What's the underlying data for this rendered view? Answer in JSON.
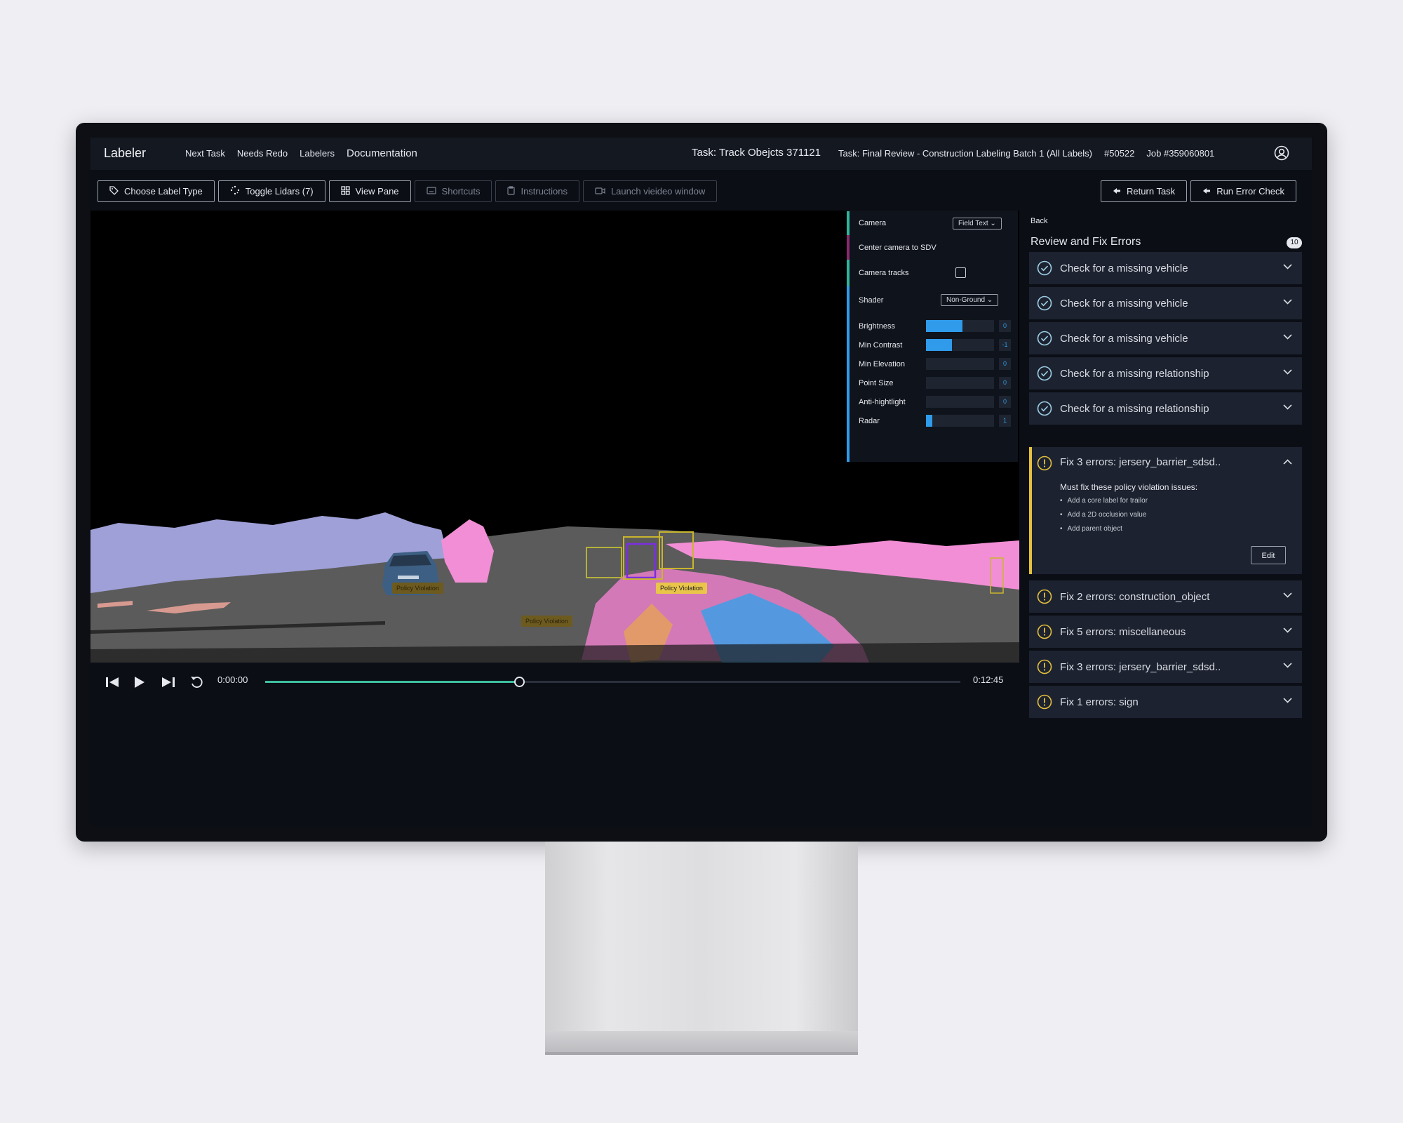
{
  "header": {
    "brand": "Labeler",
    "nav": [
      "Next Task",
      "Needs Redo",
      "Labelers",
      "Documentation"
    ],
    "task_title": "Task: Track Obejcts 371121",
    "task_review": "Task: Final Review - Construction Labeling Batch 1 (All Labels)",
    "task_number": "#50522",
    "job": "Job #359060801",
    "user_icon": "user-circle-icon"
  },
  "toolbar": {
    "left": [
      {
        "label": "Choose Label Type",
        "icon": "tag-icon"
      },
      {
        "label": "Toggle Lidars (7)",
        "icon": "sparkle-dots-icon"
      },
      {
        "label": "View Pane",
        "icon": "grid-icon"
      },
      {
        "label": "Shortcuts",
        "icon": "keyboard-icon"
      },
      {
        "label": "Instructions",
        "icon": "clipboard-icon"
      },
      {
        "label": "Launch vieideo window",
        "icon": "video-icon"
      }
    ],
    "right": [
      {
        "label": "Return Task",
        "icon": "arrow-left-icon"
      },
      {
        "label": "Run Error Check",
        "icon": "arrow-left-icon"
      }
    ]
  },
  "viewer": {
    "tags": [
      "Policy Violation",
      "Policy Violation",
      "Policy Violation"
    ]
  },
  "camera_panel": {
    "camera_label": "Camera",
    "camera_value": "Field Text",
    "center_label": "Center camera to SDV",
    "tracks_label": "Camera tracks",
    "shader_label": "Shader",
    "shader_value": "Non-Ground",
    "sliders": [
      {
        "label": "Brightness",
        "value": "0",
        "fill": 0.54
      },
      {
        "label": "Min Contrast",
        "value": "-1",
        "fill": 0.38
      },
      {
        "label": "Min Elevation",
        "value": "0",
        "fill": 0
      },
      {
        "label": "Point Size",
        "value": "0",
        "fill": 0
      },
      {
        "label": "Anti-hightlight",
        "value": "0",
        "fill": 0
      },
      {
        "label": "Radar",
        "value": "1",
        "fill": 0.09
      }
    ],
    "accent_colors": [
      "#2fb59a",
      "#8a2a6e",
      "#2fb59a",
      "#2f9bea"
    ]
  },
  "playback": {
    "current": "0:00:00",
    "total": "0:12:45",
    "progress": 0.365
  },
  "review": {
    "back": "Back",
    "title": "Review and Fix Errors",
    "count": "10",
    "checks": [
      "Check for a missing vehicle",
      "Check for a missing vehicle",
      "Check for a missing vehicle",
      "Check for a missing relationship",
      "Check for a missing relationship"
    ],
    "expanded": {
      "title": "Fix 3 errors: jersery_barrier_sdsd..",
      "message": "Must fix these policy violation issues:",
      "issues": [
        "Add a core label for trailor",
        "Add a 2D occlusion value",
        "Add parent object"
      ],
      "edit": "Edit"
    },
    "errors": [
      "Fix 2 errors: construction_object",
      "Fix 5 errors: miscellaneous",
      "Fix 3 errors: jersery_barrier_sdsd..",
      "Fix 1 errors: sign"
    ],
    "check_color": "#9fd0e6",
    "warn_color": "#e6c13b"
  }
}
